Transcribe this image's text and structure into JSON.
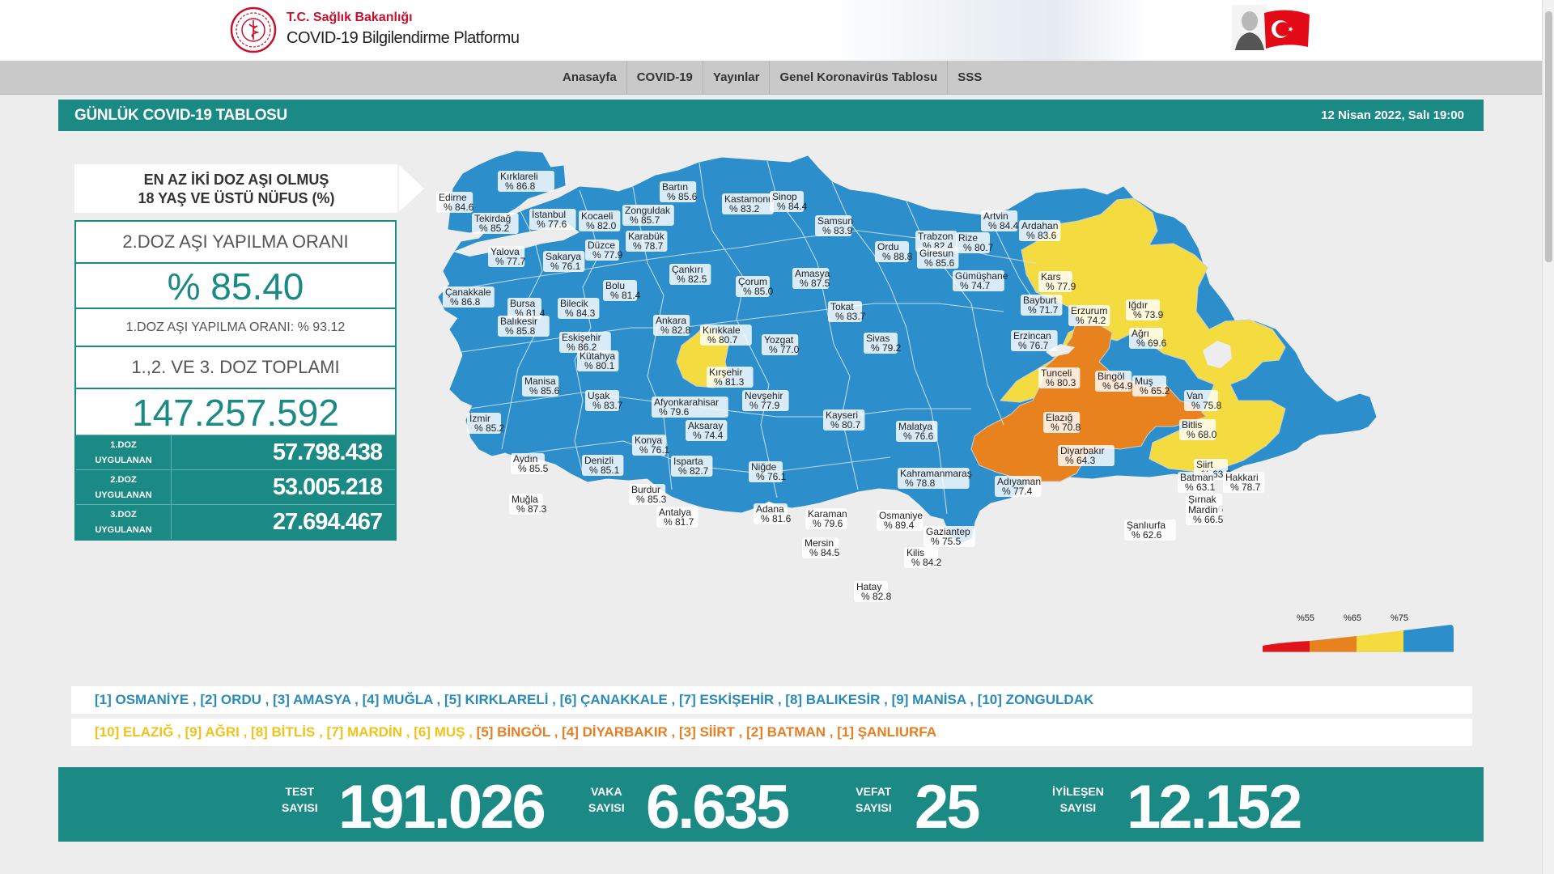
{
  "header": {
    "ministry": "T.C. Sağlık Bakanlığı",
    "platform": "COVID-19 Bilgilendirme Platformu"
  },
  "nav": {
    "items": [
      "Anasayfa",
      "COVID-19",
      "Yayınlar",
      "Genel Koronavirüs Tablosu",
      "SSS"
    ]
  },
  "title": {
    "left": "GÜNLÜK COVID-19 TABLOSU",
    "date": "12 Nisan 2022, Salı 19:00"
  },
  "vaccine": {
    "heading1": "EN AZ İKİ DOZ AŞI OLMUŞ",
    "heading2": "18 YAŞ VE ÜSTÜ NÜFUS (%)",
    "dose2_label": "2.DOZ AŞI YAPILMA ORANI",
    "dose2_value": "% 85.40",
    "dose1_rate": "1.DOZ AŞI YAPILMA ORANI: % 93.12",
    "total_label": "1.,2. VE 3. DOZ TOPLAMI",
    "total_value": "147.257.592",
    "doses": [
      {
        "l1": "1.DOZ",
        "l2": "UYGULANAN",
        "value": "57.798.438"
      },
      {
        "l1": "2.DOZ",
        "l2": "UYGULANAN",
        "value": "53.005.218"
      },
      {
        "l1": "3.DOZ",
        "l2": "UYGULANAN",
        "value": "27.694.467"
      }
    ]
  },
  "map": {
    "colors": {
      "red": "#e0131b",
      "orange": "#e8821e",
      "yellow": "#f4db3f",
      "blue": "#2c8fcb"
    },
    "legend_ticks": [
      "%55",
      "%65",
      "%75"
    ],
    "provinces": [
      {
        "name": "Kırklareli",
        "value": "% 86.8"
      },
      {
        "name": "Edirne",
        "value": "% 84.6"
      },
      {
        "name": "Tekirdağ",
        "value": "% 85.2"
      },
      {
        "name": "İstanbul",
        "value": "% 77.6"
      },
      {
        "name": "Kocaeli",
        "value": "% 82.0"
      },
      {
        "name": "Zonguldak",
        "value": "% 85.7"
      },
      {
        "name": "Bartın",
        "value": "% 85.6"
      },
      {
        "name": "Kastamonu",
        "value": "% 83.2"
      },
      {
        "name": "Sinop",
        "value": "% 84.4"
      },
      {
        "name": "Samsun",
        "value": "% 83.9"
      },
      {
        "name": "Artvin",
        "value": "% 84.4"
      },
      {
        "name": "Ardahan",
        "value": "% 83.6"
      },
      {
        "name": "Trabzon",
        "value": "% 82.4"
      },
      {
        "name": "Rize",
        "value": "% 80.7"
      },
      {
        "name": "Ordu",
        "value": "% 88.8"
      },
      {
        "name": "Giresun",
        "value": "% 85.6"
      },
      {
        "name": "Yalova",
        "value": "% 77.7"
      },
      {
        "name": "Sakarya",
        "value": "% 76.1"
      },
      {
        "name": "Düzce",
        "value": "% 77.9"
      },
      {
        "name": "Karabük",
        "value": "% 78.7"
      },
      {
        "name": "Çankırı",
        "value": "% 82.5"
      },
      {
        "name": "Çorum",
        "value": "% 85.0"
      },
      {
        "name": "Amasya",
        "value": "% 87.5"
      },
      {
        "name": "Gümüşhane",
        "value": "% 74.7"
      },
      {
        "name": "Kars",
        "value": "% 77.9"
      },
      {
        "name": "Çanakkale",
        "value": "% 86.8"
      },
      {
        "name": "Bursa",
        "value": "% 81.4"
      },
      {
        "name": "Bilecik",
        "value": "% 84.3"
      },
      {
        "name": "Bolu",
        "value": "% 81.4"
      },
      {
        "name": "Tokat",
        "value": "% 83.7"
      },
      {
        "name": "Bayburt",
        "value": "% 71.7"
      },
      {
        "name": "Erzurum",
        "value": "% 74.2"
      },
      {
        "name": "Iğdır",
        "value": "% 73.9"
      },
      {
        "name": "Balıkesir",
        "value": "% 85.8"
      },
      {
        "name": "Ankara",
        "value": "% 82.8"
      },
      {
        "name": "Kırıkkale",
        "value": "% 80.7"
      },
      {
        "name": "Eskişehir",
        "value": "% 86.2"
      },
      {
        "name": "Yozgat",
        "value": "% 77.0"
      },
      {
        "name": "Sivas",
        "value": "% 79.2"
      },
      {
        "name": "Erzincan",
        "value": "% 76.7"
      },
      {
        "name": "Ağrı",
        "value": "% 69.6"
      },
      {
        "name": "Kütahya",
        "value": "% 80.1"
      },
      {
        "name": "Tunceli",
        "value": "% 80.3"
      },
      {
        "name": "Manisa",
        "value": "% 85.6"
      },
      {
        "name": "Kırşehir",
        "value": "% 81.3"
      },
      {
        "name": "Bingöl",
        "value": "% 64.9"
      },
      {
        "name": "Muş",
        "value": "% 65.2"
      },
      {
        "name": "Uşak",
        "value": "% 83.7"
      },
      {
        "name": "Nevşehir",
        "value": "% 77.9"
      },
      {
        "name": "Kayseri",
        "value": "% 80.7"
      },
      {
        "name": "Van",
        "value": "% 75.8"
      },
      {
        "name": "İzmir",
        "value": "% 85.2"
      },
      {
        "name": "Afyonkarahisar",
        "value": "% 79.6"
      },
      {
        "name": "Aksaray",
        "value": "% 74.4"
      },
      {
        "name": "Elazığ",
        "value": "% 70.8"
      },
      {
        "name": "Bitlis",
        "value": "% 68.0"
      },
      {
        "name": "Malatya",
        "value": "% 76.6"
      },
      {
        "name": "Konya",
        "value": "% 76.1"
      },
      {
        "name": "Diyarbakır",
        "value": "% 64.3"
      },
      {
        "name": "Aydın",
        "value": "% 85.5"
      },
      {
        "name": "Denizli",
        "value": "% 85.1"
      },
      {
        "name": "Isparta",
        "value": "% 82.7"
      },
      {
        "name": "Niğde",
        "value": "% 76.1"
      },
      {
        "name": "Kahramanmaraş",
        "value": "% 78.8"
      },
      {
        "name": "Siirt",
        "value": "% 63.5"
      },
      {
        "name": "Batman",
        "value": "% 63.1"
      },
      {
        "name": "Hakkari",
        "value": "% 78.7"
      },
      {
        "name": "Adıyaman",
        "value": "% 77.4"
      },
      {
        "name": "Burdur",
        "value": "% 85.3"
      },
      {
        "name": "Şırnak",
        "value": "% 73.6"
      },
      {
        "name": "Muğla",
        "value": "% 87.3"
      },
      {
        "name": "Adana",
        "value": "% 81.6"
      },
      {
        "name": "Mardin",
        "value": "% 66.5"
      },
      {
        "name": "Antalya",
        "value": "% 81.7"
      },
      {
        "name": "Karaman",
        "value": "% 79.6"
      },
      {
        "name": "Osmaniye",
        "value": "% 89.4"
      },
      {
        "name": "Şanlıurfa",
        "value": "% 62.6"
      },
      {
        "name": "Gaziantep",
        "value": "% 75.5"
      },
      {
        "name": "Mersin",
        "value": "% 84.5"
      },
      {
        "name": "Kilis",
        "value": "% 84.2"
      },
      {
        "name": "Hatay",
        "value": "% 82.8"
      }
    ]
  },
  "rankings": {
    "best": [
      {
        "rank": "[1]",
        "name": "OSMANİYE"
      },
      {
        "rank": "[2]",
        "name": "ORDU"
      },
      {
        "rank": "[3]",
        "name": "AMASYA"
      },
      {
        "rank": "[4]",
        "name": "MUĞLA"
      },
      {
        "rank": "[5]",
        "name": "KIRKLARELİ"
      },
      {
        "rank": "[6]",
        "name": "ÇANAKKALE"
      },
      {
        "rank": "[7]",
        "name": "ESKİŞEHİR"
      },
      {
        "rank": "[8]",
        "name": "BALIKESİR"
      },
      {
        "rank": "[9]",
        "name": "MANİSA"
      },
      {
        "rank": "[10]",
        "name": "ZONGULDAK"
      }
    ],
    "worst": [
      {
        "rank": "[10]",
        "name": "ELAZIĞ",
        "tone": "yel"
      },
      {
        "rank": "[9]",
        "name": "AĞRI",
        "tone": "yel"
      },
      {
        "rank": "[8]",
        "name": "BİTLİS",
        "tone": "yel"
      },
      {
        "rank": "[7]",
        "name": "MARDİN",
        "tone": "yel"
      },
      {
        "rank": "[6]",
        "name": "MUŞ",
        "tone": "yel"
      },
      {
        "rank": "[5]",
        "name": "BİNGÖL",
        "tone": "ora"
      },
      {
        "rank": "[4]",
        "name": "DİYARBAKIR",
        "tone": "ora"
      },
      {
        "rank": "[3]",
        "name": "SİİRT",
        "tone": "ora"
      },
      {
        "rank": "[2]",
        "name": "BATMAN",
        "tone": "ora"
      },
      {
        "rank": "[1]",
        "name": "ŞANLIURFA",
        "tone": "ora"
      }
    ]
  },
  "daily": {
    "test_l1": "TEST",
    "test_l2": "SAYISI",
    "test_value": "191.026",
    "case_l1": "VAKA",
    "case_l2": "SAYISI",
    "case_value": "6.635",
    "death_l1": "VEFAT",
    "death_l2": "SAYISI",
    "death_value": "25",
    "rec_l1": "İYİLEŞEN",
    "rec_l2": "SAYISI",
    "rec_value": "12.152"
  }
}
